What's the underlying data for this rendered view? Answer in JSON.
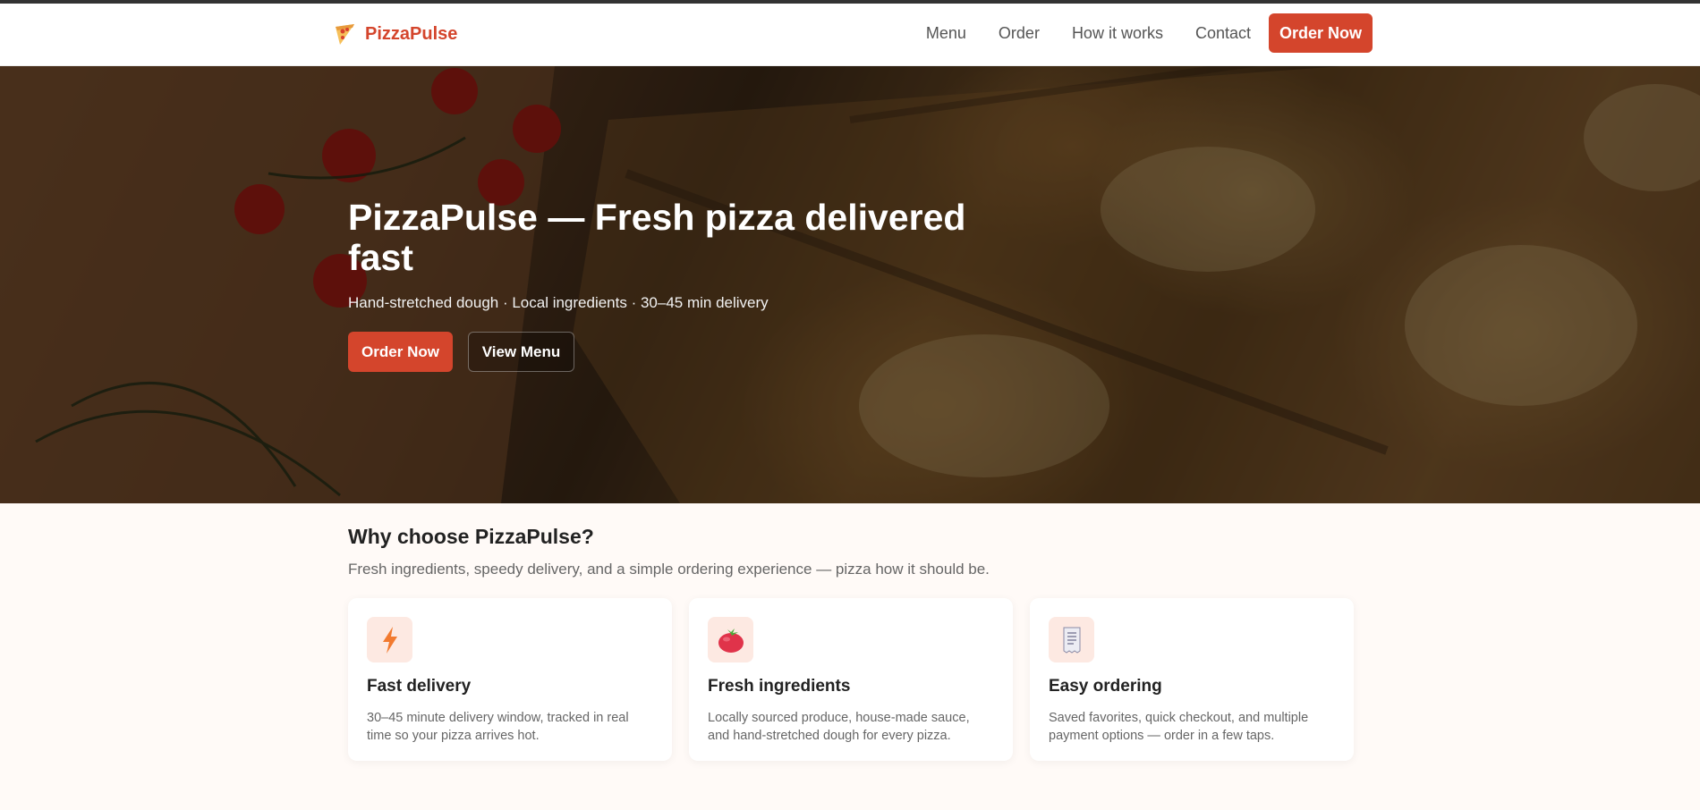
{
  "brand": {
    "name": "PizzaPulse",
    "icon": "pizza-slice-icon",
    "color": "#d4452c"
  },
  "nav": {
    "links": [
      "Menu",
      "Order",
      "How it works",
      "Contact"
    ],
    "cta": "Order Now"
  },
  "hero": {
    "title": "PizzaPulse — Fresh pizza delivered fast",
    "subtitle": "Hand-stretched dough · Local ingredients · 30–45 min delivery",
    "primary_button": "Order Now",
    "secondary_button": "View Menu"
  },
  "features": {
    "title": "Why choose PizzaPulse?",
    "subtitle": "Fresh ingredients, speedy delivery, and a simple ordering experience — pizza how it should be.",
    "cards": [
      {
        "icon": "lightning-bolt-icon",
        "title": "Fast delivery",
        "text": "30–45 minute delivery window, tracked in real time so your pizza arrives hot."
      },
      {
        "icon": "tomato-icon",
        "title": "Fresh ingredients",
        "text": "Locally sourced produce, house-made sauce, and hand-stretched dough for every pizza."
      },
      {
        "icon": "receipt-icon",
        "title": "Easy ordering",
        "text": "Saved favorites, quick checkout, and multiple payment options — order in a few taps."
      }
    ]
  },
  "colors": {
    "accent": "#d4452c",
    "features_bg": "#fffaf7",
    "icon_bg": "#fde9e2"
  }
}
